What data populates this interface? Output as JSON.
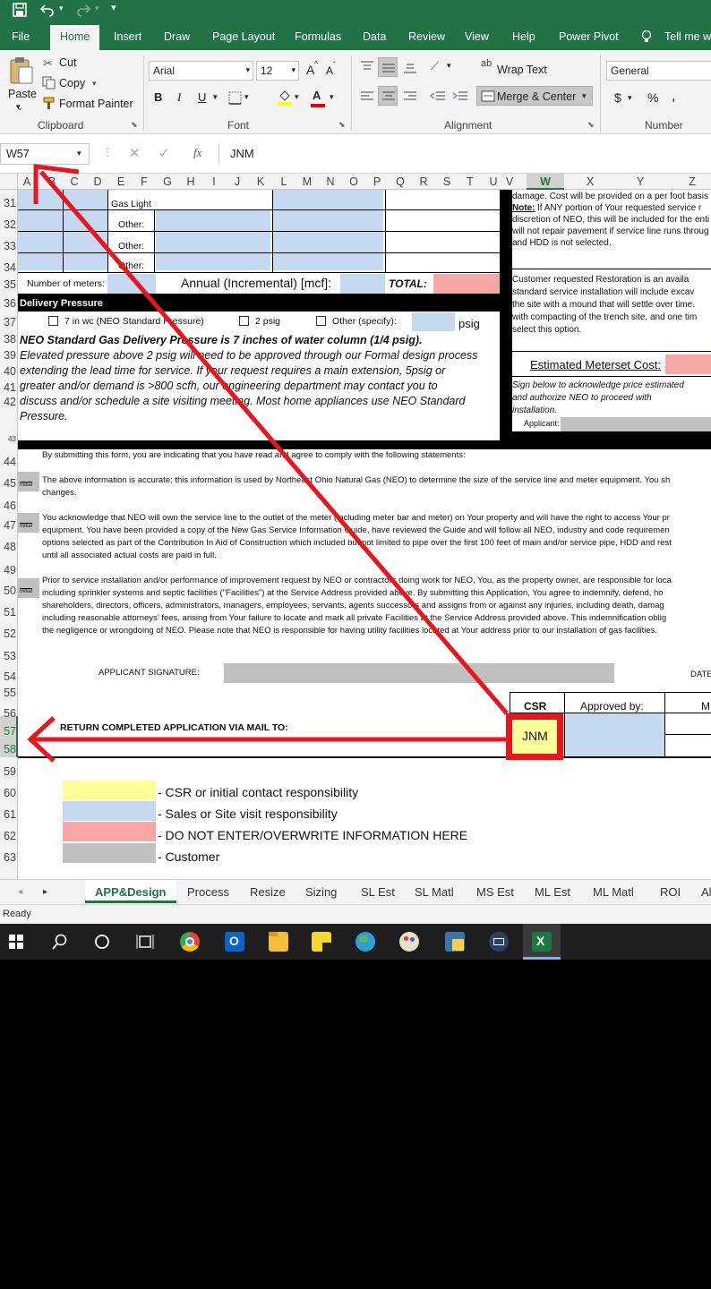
{
  "qat": {
    "save_icon": "save-icon",
    "undo_icon": "undo-icon",
    "redo_icon": "redo-icon"
  },
  "ribbon_tabs": [
    "File",
    "Home",
    "Insert",
    "Draw",
    "Page Layout",
    "Formulas",
    "Data",
    "Review",
    "View",
    "Help",
    "Power Pivot",
    "Tell me wh"
  ],
  "clipboard": {
    "paste": "Paste",
    "cut": "Cut",
    "copy": "Copy",
    "format_painter": "Format Painter",
    "group": "Clipboard"
  },
  "font": {
    "name": "Arial",
    "size": "12",
    "group": "Font",
    "bold": "B",
    "italic": "I",
    "underline": "U",
    "grow": "A",
    "shrink": "A"
  },
  "alignment": {
    "wrap_text": "Wrap Text",
    "merge_center": "Merge & Center",
    "group": "Alignment"
  },
  "number": {
    "format": "General",
    "currency": "$",
    "percent": "%",
    "group": "Number"
  },
  "formula_bar": {
    "name_box": "W57",
    "fx": "fx",
    "value": "JNM"
  },
  "columns": [
    "A",
    "B",
    "C",
    "D",
    "E",
    "F",
    "G",
    "H",
    "I",
    "J",
    "K",
    "L",
    "M",
    "N",
    "O",
    "P",
    "Q",
    "R",
    "S",
    "T",
    "U",
    "V",
    "W",
    "X",
    "Y",
    "Z"
  ],
  "rows": [
    "31",
    "32",
    "33",
    "34",
    "35",
    "36",
    "37",
    "38",
    "39",
    "40",
    "41",
    "42",
    "43",
    "44",
    "45",
    "46",
    "47",
    "48",
    "49",
    "50",
    "51",
    "52",
    "53",
    "54",
    "55",
    "56",
    "57",
    "58",
    "59",
    "60",
    "61",
    "62",
    "63"
  ],
  "sheet": {
    "gas_light": "Gas Light",
    "other": "Other:",
    "number_of_meters": "Number of meters:",
    "annual": "Annual (Incremental) [mcf]:",
    "total": "TOTAL:",
    "delivery_pressure": "Delivery Pressure",
    "opt1": "7 in wc (NEO Standard Pressure)",
    "opt2": "2 psig",
    "opt3": "Other (specify):",
    "psig": "psig",
    "neo_standard": "NEO Standard Gas Delivery Pressure is 7 inches of water column (1/4 psig).",
    "elevated_lines": [
      "Elevated pressure above 2 psig will need to be approved through our Formal design process",
      "extending the lead time for service.  If your request requires a main extension, 5psig or",
      "greater and/or demand is >800 scfh, our engineering department may contact you to",
      "discuss and/or schedule a site visiting meeting. Most home appliances use NEO Standard",
      "Pressure."
    ],
    "right_damage": "damage.  Cost will be provided on a per foot basis",
    "right_note_label": "Note:",
    "right_note": " If ANY portion of Your requested service r",
    "right_line3": "discretion of NEO, this will be included for the enti",
    "right_line4": "will not repair pavement if service line runs throug",
    "right_line5": "and HDD is not selected.",
    "restoration_lines": [
      "Customer requested Restoration is an availa",
      "standard service installation will include excav",
      "the site with a mound that will settle over time.",
      "with compacting of the trench site, and one tim",
      "select this option."
    ],
    "estimated_cost": "Estimated Meterset Cost:",
    "sign_below": [
      "Sign below to acknowledge price estimated",
      "and authorize NEO to proceed with",
      "installation."
    ],
    "applicant": "Applicant:",
    "by_submitting": "By submitting this form, you are indicating that you have read and agree to comply with the following statements:",
    "initial": "Initial",
    "para45": [
      "The above information is accurate; this information is used by Northeast Ohio Natural Gas (NEO) to determine the size of the service line and meter equipment. You sh",
      "changes."
    ],
    "para47": [
      "You acknowledge that NEO will own the service line to the outlet of the meter (including meter bar and meter) on Your property and will have the right to access Your pr",
      "equipment.  You have been provided a copy of the New Gas Service Information Guide, have reviewed the Guide and will follow all NEO, industry and code requiremen",
      "options selected as part of the Contribution In Aid of Construction which included but not limited to pipe over the first 100 feet of main and/or service pipe, HDD and rest",
      "until all associated actual costs are paid in full."
    ],
    "para50": [
      "Prior to service installation and/or performance of improvement request by NEO or contractors doing work for NEO, You, as the property owner, are responsible for loca",
      "including sprinkler systems and septic facilities (\"Facilities\") at the Service Address provided above. By submitting this Application, You agree to indemnify, defend, ho",
      "shareholders, directors, officers, administrators, managers, employees, servants, agents successors and assigns from or against any injuries, including death, damag",
      "including reasonable attorneys' fees, arising from Your failure to locate and mark all private Facilities at the Service Address provided above. This indemnification oblig",
      "the negligence or wrongdoing of NEO. Please note that NEO is responsible for having utility facilities located at Your address prior to our installation of gas facilities."
    ],
    "applicant_signature": "APPLICANT SIGNATURE:",
    "date": "DATE",
    "csr": "CSR",
    "approved_by": "Approved by:",
    "m_col": "M",
    "return": "RETURN COMPLETED APPLICATION VIA MAIL TO:",
    "jnm": "JNM",
    "legend": [
      "- CSR or initial contact responsibility",
      "- Sales or Site visit responsibility",
      "- DO NOT ENTER/OVERWRITE INFORMATION HERE",
      "- Customer"
    ]
  },
  "sheet_tabs": [
    "APP&Design",
    "Process",
    "Resize",
    "Sizing",
    "SL Est",
    "SL Matl",
    "MS Est",
    "ML Est",
    "ML Matl",
    "ROI",
    "Al"
  ],
  "status": "Ready",
  "taskbar_icons": [
    "windows-start-icon",
    "search-icon",
    "cortana-icon",
    "task-view-icon",
    "chrome-icon",
    "outlook-icon",
    "file-explorer-icon",
    "sticky-notes-icon",
    "network-globe-icon",
    "paint-icon",
    "python-icon",
    "app-icon",
    "excel-icon"
  ],
  "colors": {
    "excel_green": "#217346",
    "blue_fill": "#c5d9f1",
    "pink_fill": "#f8a7a7",
    "gray_fill": "#c0c0c0",
    "yellow_fill": "#ffff99",
    "annotation_red": "#e8141e"
  }
}
